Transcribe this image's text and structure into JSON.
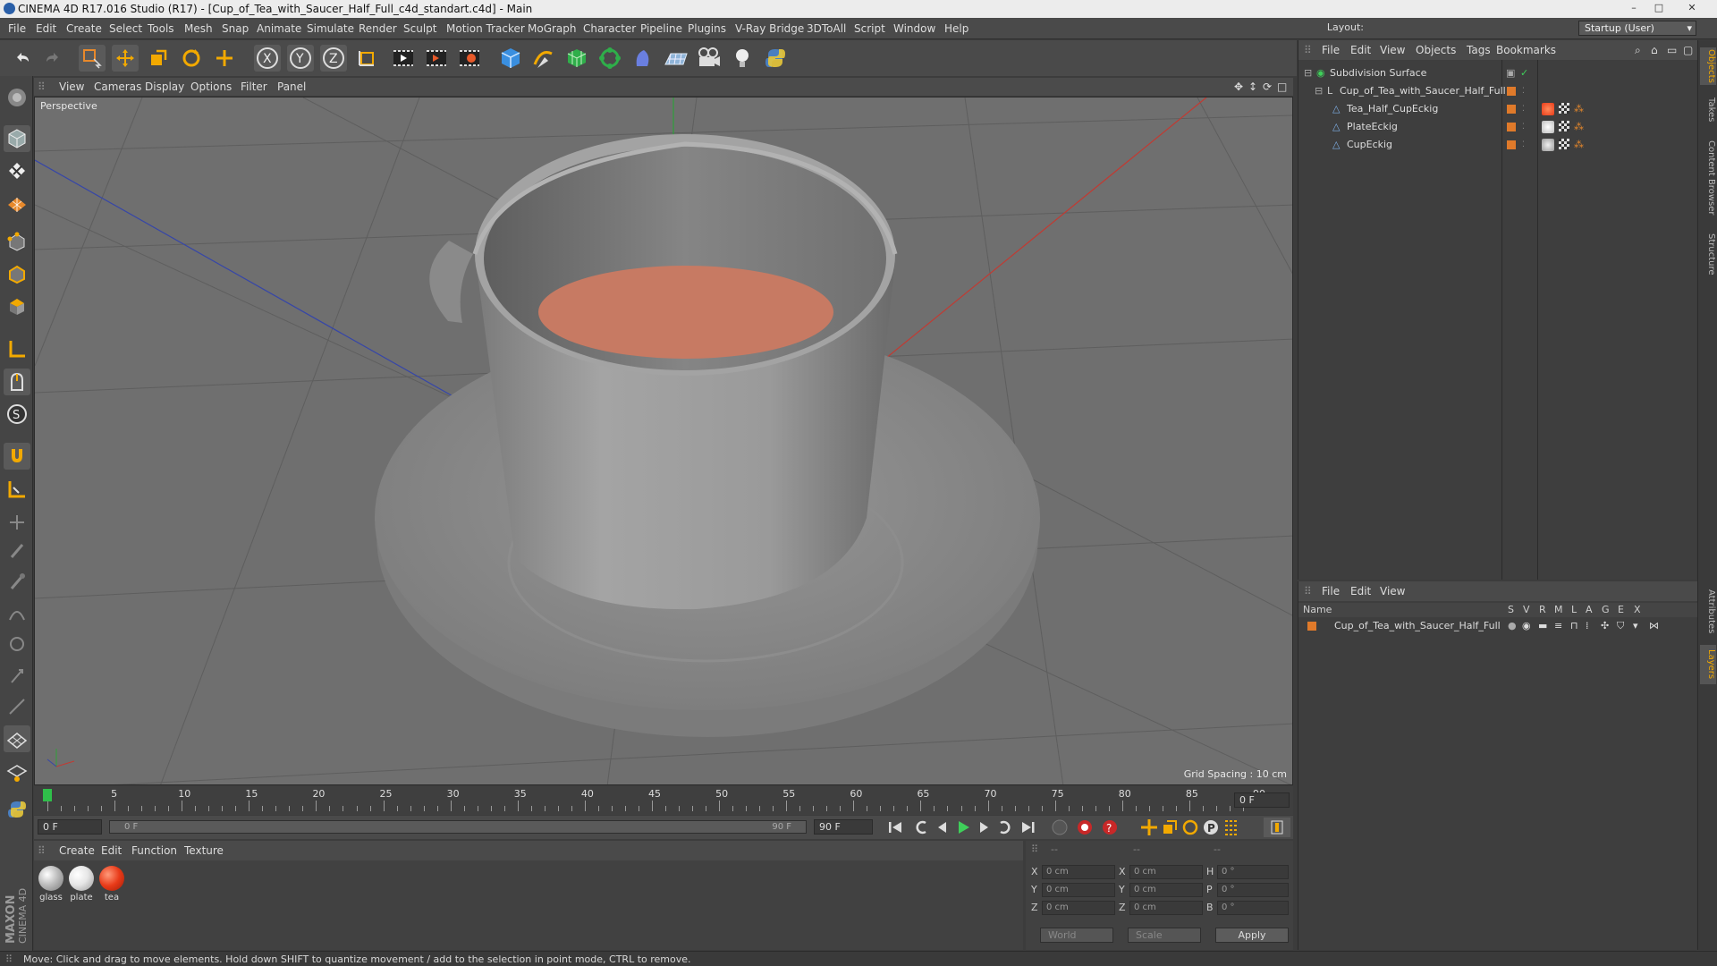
{
  "window": {
    "title": "CINEMA 4D R17.016 Studio (R17) - [Cup_of_Tea_with_Saucer_Half_Full_c4d_standart.c4d] - Main",
    "controls": [
      "–",
      "□",
      "✕"
    ]
  },
  "menubar": {
    "items": [
      "File",
      "Edit",
      "Create",
      "Select",
      "Tools",
      "Mesh",
      "Snap",
      "Animate",
      "Simulate",
      "Render",
      "Sculpt",
      "Motion Tracker",
      "MoGraph",
      "Character",
      "Pipeline",
      "Plugins",
      "V-Ray Bridge",
      "3DToAll",
      "Script",
      "Window",
      "Help"
    ],
    "layout_label": "Layout:",
    "layout_value": "Startup (User)"
  },
  "toolbar": {
    "icons": [
      "undo-icon",
      "redo-icon",
      "live-select-icon",
      "move-icon",
      "scale-icon",
      "rotate-icon",
      "recent-tool-icon",
      "x-axis-icon",
      "y-axis-icon",
      "z-axis-icon",
      "world-coord-icon",
      "render-view-icon",
      "render-picture-viewer-icon",
      "render-settings-icon",
      "cube-primitive-icon",
      "spline-pen-icon",
      "subdivision-icon",
      "cloner-icon",
      "deformer-icon",
      "floor-icon",
      "camera-icon",
      "light-icon",
      "python-icon"
    ]
  },
  "viewport": {
    "menu": [
      "View",
      "Cameras",
      "Display",
      "Options",
      "Filter",
      "Panel"
    ],
    "label": "Perspective",
    "grid_spacing": "Grid Spacing : 10 cm"
  },
  "timeline": {
    "ticks": [
      "0",
      "5",
      "10",
      "15",
      "20",
      "25",
      "30",
      "35",
      "40",
      "45",
      "50",
      "55",
      "60",
      "65",
      "70",
      "75",
      "80",
      "85",
      "90"
    ],
    "current_frame": "0 F",
    "start_field": "0 F",
    "range_start": "0 F",
    "range_end": "90 F",
    "end_field": "90 F"
  },
  "materials": {
    "menu": [
      "Create",
      "Edit",
      "Function",
      "Texture"
    ],
    "items": [
      {
        "name": "glass",
        "color": "#bdbdbd"
      },
      {
        "name": "plate",
        "color": "#e6e6e6"
      },
      {
        "name": "tea",
        "color": "#e83a18"
      }
    ]
  },
  "coordinates": {
    "header": [
      "--",
      "--",
      "--"
    ],
    "rows": [
      {
        "l1": "X",
        "v1": "0 cm",
        "l2": "X",
        "v2": "0 cm",
        "l3": "H",
        "v3": "0 °"
      },
      {
        "l1": "Y",
        "v1": "0 cm",
        "l2": "Y",
        "v2": "0 cm",
        "l3": "P",
        "v3": "0 °"
      },
      {
        "l1": "Z",
        "v1": "0 cm",
        "l2": "Z",
        "v2": "0 cm",
        "l3": "B",
        "v3": "0 °"
      }
    ],
    "mode": "World",
    "scale": "Scale",
    "apply": "Apply"
  },
  "objects": {
    "menu": [
      "File",
      "Edit",
      "View",
      "Objects",
      "Tags",
      "Bookmarks"
    ],
    "items": [
      {
        "name": "Subdivision Surface",
        "depth": 0
      },
      {
        "name": "Cup_of_Tea_with_Saucer_Half_Full",
        "depth": 1
      },
      {
        "name": "Tea_Half_CupEckig",
        "depth": 2
      },
      {
        "name": "PlateEckig",
        "depth": 2
      },
      {
        "name": "CupEckig",
        "depth": 2
      }
    ]
  },
  "layers": {
    "menu": [
      "File",
      "Edit",
      "View"
    ],
    "col_name": "Name",
    "cols": [
      "S",
      "V",
      "R",
      "M",
      "L",
      "A",
      "G",
      "E",
      "X"
    ],
    "rows": [
      "Cup_of_Tea_with_Saucer_Half_Full"
    ]
  },
  "side_tabs": [
    "Objects",
    "Takes",
    "Content Browser",
    "Structure",
    "Attributes",
    "Layers"
  ],
  "status": "Move: Click and drag to move elements. Hold down SHIFT to quantize movement / add to the selection in point mode, CTRL to remove.",
  "colors": {
    "accent": "#2a6fc8",
    "tea": "#c77a63",
    "orange": "#e07a2a"
  }
}
